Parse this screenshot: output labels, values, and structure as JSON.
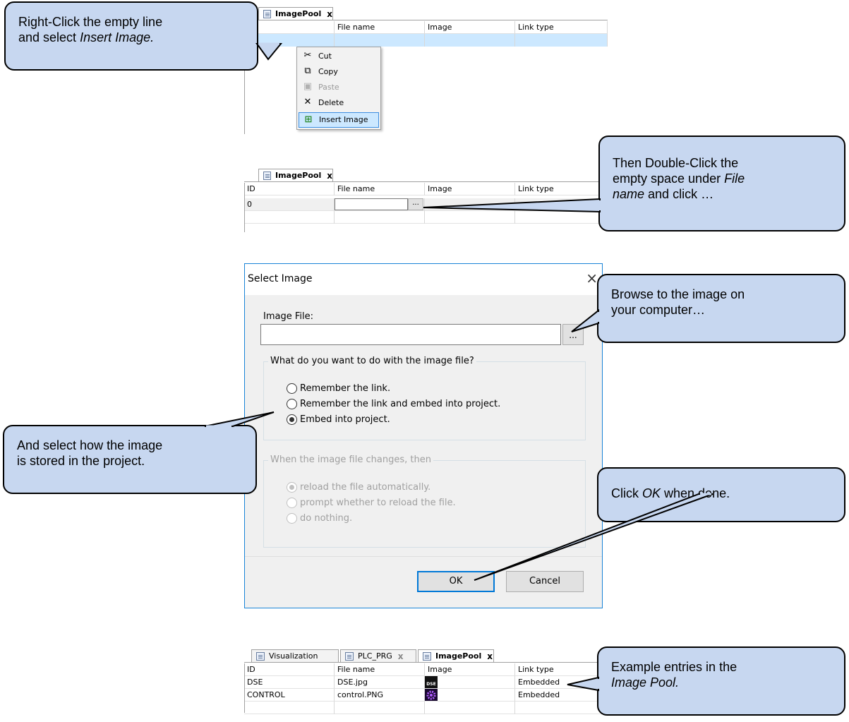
{
  "panel1": {
    "tab_label": "ImagePool",
    "columns": [
      "File name",
      "Image",
      "Link type"
    ]
  },
  "context_menu": {
    "items": [
      {
        "label": "Cut",
        "icon": "scissors-icon",
        "enabled": true
      },
      {
        "label": "Copy",
        "icon": "copy-icon",
        "enabled": true
      },
      {
        "label": "Paste",
        "icon": "paste-icon",
        "enabled": false
      },
      {
        "label": "Delete",
        "icon": "delete-x-icon",
        "enabled": true
      },
      {
        "label": "Insert Image",
        "icon": "insert-image-icon",
        "enabled": true,
        "highlighted": true
      }
    ]
  },
  "panel2": {
    "tab_label": "ImagePool",
    "columns": [
      "ID",
      "File name",
      "Image",
      "Link type"
    ],
    "row": {
      "id": "0",
      "browse": "..."
    }
  },
  "dialog": {
    "title": "Select Image",
    "close": "×",
    "image_file_label": "Image File:",
    "image_file_value": "",
    "browse_label": "...",
    "group1": {
      "title": "What do you want to do with the image file?",
      "options": [
        "Remember the link.",
        "Remember the link and embed into project.",
        "Embed into project."
      ],
      "selected": 2
    },
    "group2": {
      "title": "When the image file changes, then",
      "options": [
        "reload the file automatically.",
        "prompt whether to reload the file.",
        "do nothing."
      ],
      "selected": 0,
      "enabled": false
    },
    "ok": "OK",
    "cancel": "Cancel"
  },
  "panel3": {
    "tabs": [
      {
        "label": "Visualization",
        "active": false,
        "closable": false
      },
      {
        "label": "PLC_PRG",
        "active": false,
        "closable": true
      },
      {
        "label": "ImagePool",
        "active": true,
        "closable": true
      }
    ],
    "columns": [
      "ID",
      "File name",
      "Image",
      "Link type"
    ],
    "rows": [
      {
        "id": "DSE",
        "file": "DSE.jpg",
        "image_badge": "DSE",
        "link": "Embedded"
      },
      {
        "id": "CONTROL",
        "file": "control.PNG",
        "image_badge": "",
        "link": "Embedded"
      }
    ]
  },
  "callouts": {
    "c1": {
      "line1": "Right-Click the empty line",
      "line2_pre": "and select ",
      "line2_em": "Insert Image."
    },
    "c2": {
      "line1": "Then Double-Click the",
      "line2_pre": "empty space under ",
      "line2_em": "File",
      "line3_em": "name",
      "line3_post": " and click …"
    },
    "c3": {
      "line1": "Browse to the image on",
      "line2": "your computer…"
    },
    "c4": {
      "line1": "And select how the image",
      "line2": "is stored in the project."
    },
    "c5": {
      "pre": "Click ",
      "em": "OK",
      "post": " when done."
    },
    "c6": {
      "line1": "Example entries in the",
      "line2_em": "Image Pool."
    }
  },
  "colors": {
    "callout_fill": "#c7d7f0",
    "selected_row": "#cce8ff",
    "dialog_border": "#1883d7",
    "default_button_border": "#0078d7"
  }
}
